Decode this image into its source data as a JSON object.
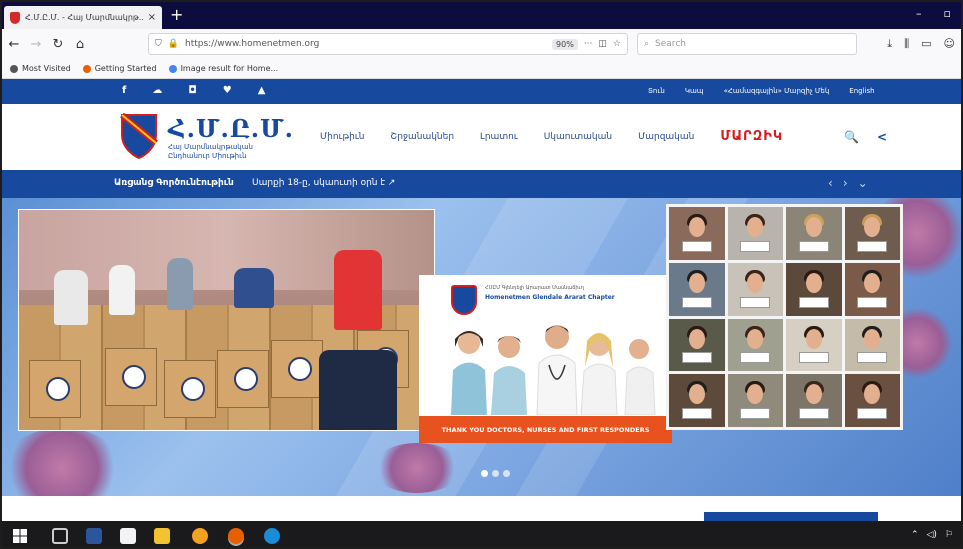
{
  "browser": {
    "tab_title": "Հ.Մ.Ը.Մ. - Հայ Մարմնակրթ...",
    "tab_close": "×",
    "new_tab": "+",
    "url": "https://www.homenetmen.org",
    "zoom": "90%",
    "page_actions": "···",
    "search_placeholder": "Search",
    "window_minimize": "–",
    "window_maximize": "▫"
  },
  "bookmarks": [
    {
      "label": "Most Visited",
      "color": "#555555"
    },
    {
      "label": "Getting Started",
      "color": "#e66000"
    },
    {
      "label": "Image result for Home...",
      "color": "#4285f4"
    }
  ],
  "site": {
    "social_icons": [
      "f",
      "☁",
      "◘",
      "♥",
      "▲"
    ],
    "top_links": [
      "Տուն",
      "Կապ",
      "«Համազգային» Մարզիչ Մեկ",
      "English"
    ],
    "brand_name": "Հ.Մ.Ը.Մ.",
    "brand_sub_1": "Հայ Մարմնակրթական",
    "brand_sub_2": "Ընդհանուր Միութիւն",
    "menu": [
      "Միութիւն",
      "Շրջանակներ",
      "Լրատու",
      "Սկաուտական",
      "Մարզական"
    ],
    "menu_special": "ՄԱՐԶԻԿ",
    "search_icon": "🔍",
    "share_icon": "<",
    "announce_label": "Առցանց Գործունէութիւն",
    "announce_text": "Սարքի 18-ը, սկաուտի օրն է ↗",
    "announce_ctrls": [
      "‹",
      "›",
      "⌄"
    ]
  },
  "hero": {
    "center_org": "ՀՄԸՄ Գլենդելի Արարատ Մասնաճիւղ",
    "center_chapter": "Homenetmen Glendale Ararat Chapter",
    "center_banner": "THANK YOU DOCTORS, NURSES AND FIRST RESPONDERS",
    "slides": 3,
    "active_slide": 0
  },
  "colors": {
    "brand_blue": "#174a9e",
    "brand_red": "#d11f1f",
    "banner_orange": "#e8521f"
  }
}
